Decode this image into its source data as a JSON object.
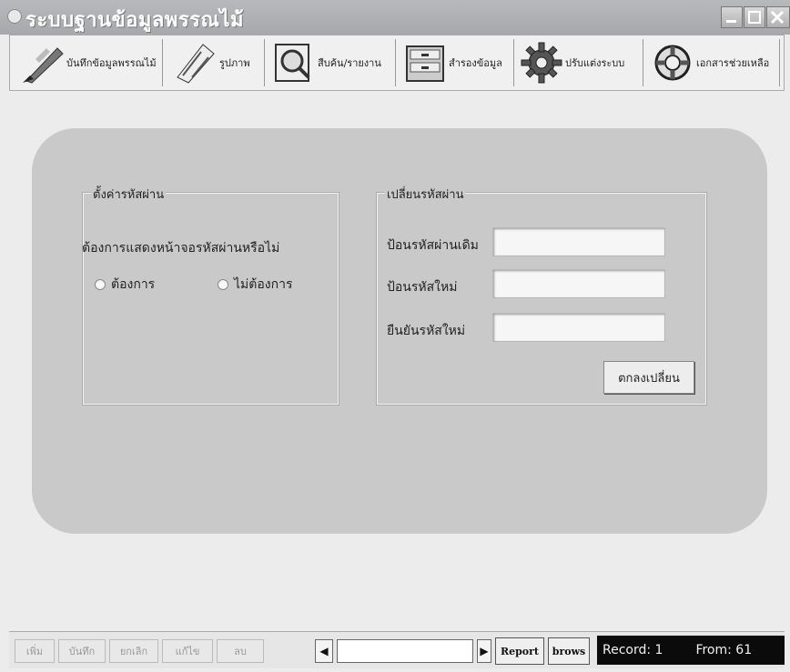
{
  "window": {
    "title": "ระบบฐานข้อมูลพรรณไม้"
  },
  "toolbar": {
    "items": [
      {
        "label": "บันทึกข้อมูลพรรณไม้",
        "icon": "pen-icon"
      },
      {
        "label": "รูปภาพ",
        "icon": "picture-icon"
      },
      {
        "label": "สืบค้น/รายงาน",
        "icon": "search-icon"
      },
      {
        "label": "สำรองข้อมูล",
        "icon": "cabinet-icon"
      },
      {
        "label": "ปรับแต่งระบบ",
        "icon": "gear-icon"
      },
      {
        "label": "เอกสารช่วยเหลือ",
        "icon": "lifebuoy-icon"
      }
    ]
  },
  "password_settings": {
    "legend": "ตั้งค่ารหัสผ่าน",
    "question": "ต้องการแสดงหน้าจอรหัสผ่านหรือไม่",
    "option_yes": "ต้องการ",
    "option_no": "ไม่ต้องการ"
  },
  "change_password": {
    "legend": "เปลี่ยนรหัสผ่าน",
    "old_label": "ป้อนรหัสผ่านเดิม",
    "old_value": "",
    "new_label": "ป้อนรหัสใหม่",
    "new_value": "",
    "confirm_label": "ยืนยันรหัสใหม่",
    "confirm_value": "",
    "submit_label": "ตกลงเปลี่ยน"
  },
  "statusbar": {
    "add_label": "เพิ่ม",
    "save_label": "บันทึก",
    "cancel_label": "ยกเลิก",
    "edit_label": "แก้ไข",
    "delete_label": "ลบ",
    "prev_glyph": "◀",
    "next_glyph": "▶",
    "nav_value": "",
    "report_label": "Report",
    "brows_label": "brows",
    "record_text": "Record: 1",
    "from_text": "From: 61"
  },
  "colors": {
    "panel": "#c9c9c9",
    "background": "#ececec",
    "titlebar": "#a9abaf"
  }
}
